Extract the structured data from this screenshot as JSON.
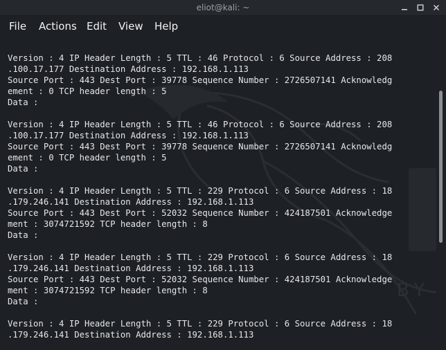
{
  "window": {
    "title": "eliot@kali: ~"
  },
  "menu": {
    "items": [
      "File",
      "Actions",
      "Edit",
      "View",
      "Help"
    ]
  },
  "watermark": {
    "text": "BY O"
  },
  "terminal": {
    "lines": [
      "Version : 4 IP Header Length : 5 TTL : 46 Protocol : 6 Source Address : 208",
      ".100.17.177 Destination Address : 192.168.1.113",
      "Source Port : 443 Dest Port : 39778 Sequence Number : 2726507141 Acknowledg",
      "ement : 0 TCP header length : 5",
      "Data :",
      "",
      "Version : 4 IP Header Length : 5 TTL : 46 Protocol : 6 Source Address : 208",
      ".100.17.177 Destination Address : 192.168.1.113",
      "Source Port : 443 Dest Port : 39778 Sequence Number : 2726507141 Acknowledg",
      "ement : 0 TCP header length : 5",
      "Data :",
      "",
      "Version : 4 IP Header Length : 5 TTL : 229 Protocol : 6 Source Address : 18",
      ".179.246.141 Destination Address : 192.168.1.113",
      "Source Port : 443 Dest Port : 52032 Sequence Number : 424187501 Acknowledge",
      "ment : 3074721592 TCP header length : 8",
      "Data :",
      "",
      "Version : 4 IP Header Length : 5 TTL : 229 Protocol : 6 Source Address : 18",
      ".179.246.141 Destination Address : 192.168.1.113",
      "Source Port : 443 Dest Port : 52032 Sequence Number : 424187501 Acknowledge",
      "ment : 3074721592 TCP header length : 8",
      "Data :",
      "",
      "Version : 4 IP Header Length : 5 TTL : 229 Protocol : 6 Source Address : 18",
      ".179.246.141 Destination Address : 192.168.1.113"
    ]
  },
  "colors": {
    "background": "#1d2024",
    "text": "#e6e8ea",
    "titlebar": "#25292e"
  }
}
